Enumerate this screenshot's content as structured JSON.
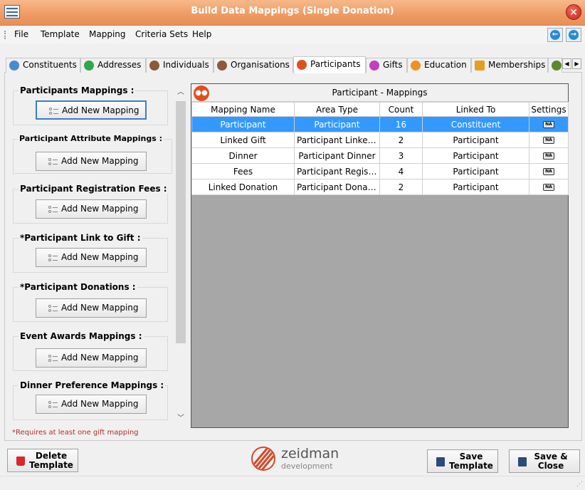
{
  "window": {
    "title": "Build Data Mappings (Single Donation)"
  },
  "menu": [
    "File",
    "Template",
    "Mapping",
    "Criteria Sets",
    "Help"
  ],
  "tabs": [
    {
      "label": "Constituents",
      "icon": "constituents-icon",
      "color": "#4a8ad0"
    },
    {
      "label": "Addresses",
      "icon": "home-icon",
      "color": "#2ea84a"
    },
    {
      "label": "Individuals",
      "icon": "people-icon",
      "color": "#8a5a3a"
    },
    {
      "label": "Organisations",
      "icon": "organisation-icon",
      "color": "#8a5a3a"
    },
    {
      "label": "Participants",
      "icon": "participants-icon",
      "color": "#e0501e"
    },
    {
      "label": "Gifts",
      "icon": "gift-icon",
      "color": "#c040c0"
    },
    {
      "label": "Education",
      "icon": "education-icon",
      "color": "#f09020"
    },
    {
      "label": "Memberships",
      "icon": "lock-icon",
      "color": "#e0a020"
    }
  ],
  "groups": [
    {
      "title": "Participants Mappings :",
      "button": "Add New Mapping"
    },
    {
      "title": "Participant Attribute Mappings :",
      "button": "Add New Mapping"
    },
    {
      "title": "Participant Registration Fees :",
      "button": "Add New Mapping"
    },
    {
      "title": "*Participant Link to Gift :",
      "button": "Add New Mapping"
    },
    {
      "title": "*Participant Donations :",
      "button": "Add New Mapping"
    },
    {
      "title": "Event Awards Mappings :",
      "button": "Add New Mapping"
    },
    {
      "title": "Dinner Preference Mappings :",
      "button": "Add New Mapping"
    }
  ],
  "footnote": "*Requires at least one gift mapping",
  "grid": {
    "title": "Participant - Mappings",
    "columns": [
      "Mapping Name",
      "Area Type",
      "Count",
      "Linked To",
      "Settings"
    ],
    "rows": [
      {
        "name": "Participant",
        "area": "Participant",
        "count": "16",
        "linked": "Constituent",
        "settings": "NA",
        "selected": true
      },
      {
        "name": "Linked Gift",
        "area": "Participant Linked Gift",
        "count": "2",
        "linked": "Participant",
        "settings": "NA"
      },
      {
        "name": "Dinner",
        "area": "Participant Dinner",
        "count": "3",
        "linked": "Participant",
        "settings": "NA"
      },
      {
        "name": "Fees",
        "area": "Participant Registration Fees",
        "count": "4",
        "linked": "Participant",
        "settings": "NA"
      },
      {
        "name": "Linked Donation",
        "area": "Participant Donation",
        "count": "2",
        "linked": "Participant",
        "settings": "NA"
      }
    ]
  },
  "buttons": {
    "delete": "Delete Template",
    "save": "Save Template",
    "save_close": "Save & Close"
  },
  "logo": {
    "name": "zeidman",
    "sub": "development"
  },
  "colors": {
    "titlebar": "#ee9a63",
    "selection": "#3399ff",
    "accent": "#e0501e"
  }
}
